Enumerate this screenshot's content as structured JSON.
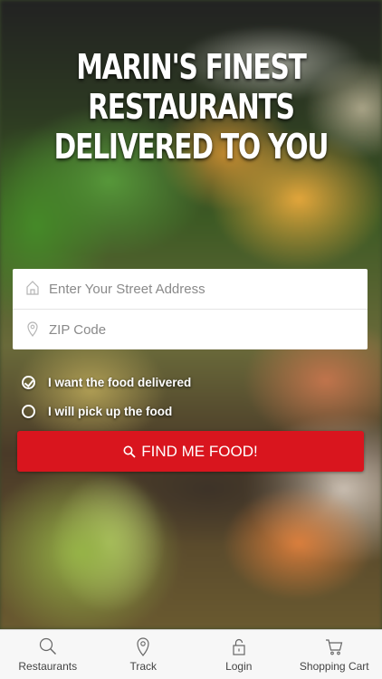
{
  "hero": {
    "headline": "MARIN'S FINEST RESTAURANTS DELIVERED TO YOU"
  },
  "address_form": {
    "street_placeholder": "Enter Your Street Address",
    "zip_placeholder": "ZIP Code",
    "street_icon": "home-icon",
    "zip_icon": "location-pin-icon"
  },
  "delivery_options": [
    {
      "label": "I want the food delivered",
      "selected": true
    },
    {
      "label": "I will pick up the food",
      "selected": false
    }
  ],
  "cta": {
    "label": "FIND ME FOOD!",
    "icon": "search-icon",
    "color": "#d9151e"
  },
  "tabbar": {
    "items": [
      {
        "label": "Restaurants",
        "icon": "search-icon"
      },
      {
        "label": "Track",
        "icon": "location-pin-icon"
      },
      {
        "label": "Login",
        "icon": "lock-icon"
      },
      {
        "label": "Shopping Cart",
        "icon": "cart-icon"
      }
    ]
  }
}
